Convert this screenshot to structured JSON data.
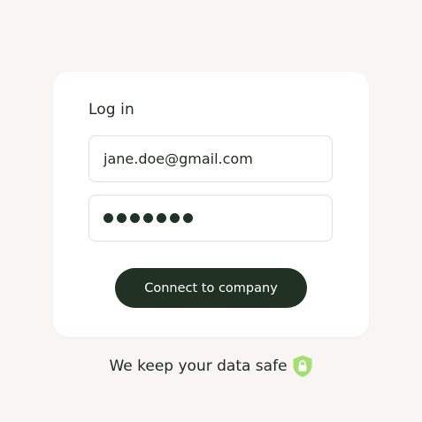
{
  "login": {
    "title": "Log in",
    "email_value": "jane.doe@gmail.com",
    "password_mask_count": 7,
    "connect_label": "Connect to company"
  },
  "footer": {
    "text": "We keep your data safe",
    "icon": "lock-shield-icon"
  },
  "colors": {
    "background": "#f8f5f3",
    "card": "#ffffff",
    "button": "#213225",
    "text": "#1f2a22",
    "shield": "#a4e06f"
  }
}
